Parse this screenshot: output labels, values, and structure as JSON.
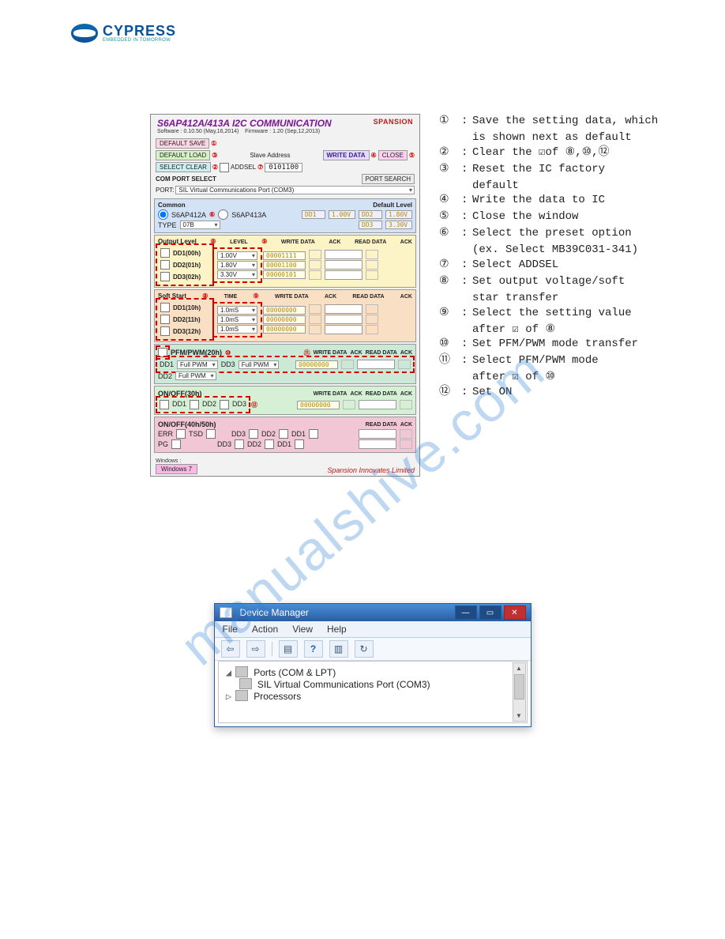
{
  "brand": {
    "name": "CYPRESS",
    "tagline": "EMBEDDED IN TOMORROW"
  },
  "watermark": "manualshive.com",
  "i2cWindow": {
    "title": "S6AP412A/413A I2C COMMUNICATION",
    "software": "Software : 0.10.50 (May,16,2014)",
    "firmware": "Firmware : 1.20 (Sep,12,2013)",
    "vendor": "SPANSION",
    "buttons": {
      "defaultSave": "DEFAULT SAVE",
      "defaultLoad": "DEFAULT LOAD",
      "selectClear": "SELECT CLEAR",
      "writeData": "WRITE DATA",
      "close": "CLOSE",
      "portSearch": "PORT SEARCH"
    },
    "addsel": {
      "label": "ADDSEL",
      "value": "0101100"
    },
    "slaveAddressLabel": "Slave Address",
    "comPortSelectLabel": "COM PORT SELECT",
    "portLabel": "PORT:",
    "portValue": "SIL Virtual Communications Port (COM3)",
    "common": {
      "header": "Common",
      "chipA": "S6AP412A",
      "chipB": "S6AP413A",
      "typeLabel": "TYPE",
      "typeValue": "07B",
      "defaultLevelLabel": "Default Level",
      "dd1": "DD1",
      "dd1v": "1.00V",
      "dd2": "DD2",
      "dd2v": "1.80V",
      "dd3": "DD3",
      "dd3v": "3.30V"
    },
    "colHeaders": {
      "level": "LEVEL",
      "time": "TIME",
      "writeData": "WRITE DATA",
      "ack": "ACK",
      "readData": "READ DATA"
    },
    "outputLevel": {
      "header": "Output Level",
      "rows": [
        {
          "cb": "DD1(00h)",
          "sel": "1.00V",
          "wd": "00001111"
        },
        {
          "cb": "DD2(01h)",
          "sel": "1.80V",
          "wd": "00001100"
        },
        {
          "cb": "DD3(02h)",
          "sel": "3.30V",
          "wd": "00000101"
        }
      ]
    },
    "softStart": {
      "header": "Soft Start",
      "rows": [
        {
          "cb": "DD1(10h)",
          "sel": "1.0mS",
          "wd": "00000000"
        },
        {
          "cb": "DD2(11h)",
          "sel": "1.0mS",
          "wd": "00000000"
        },
        {
          "cb": "DD3(12h)",
          "sel": "1.0mS",
          "wd": "00000000"
        }
      ]
    },
    "pfmPwm": {
      "header": "PFM/PWM(20h)",
      "wd": "00000000",
      "dd1Label": "DD1",
      "dd1Val": "Full PWM",
      "dd2Label": "DD2",
      "dd2Val": "Full PWM",
      "dd3Label": "DD3",
      "dd3Val": "Full PWM"
    },
    "onOff": {
      "header": "ON/OFF(30h)",
      "wd": "00000000",
      "dd1": "DD1",
      "dd2": "DD2",
      "dd3": "DD3"
    },
    "ro": {
      "header": "ON/OFF(40h/50h)",
      "err": "ERR",
      "tsd": "TSD",
      "pg": "PG",
      "dd1": "DD1",
      "dd2": "DD2",
      "dd3": "DD3"
    },
    "footer": {
      "osLabel": "Windows :",
      "osValue": "Windows 7",
      "tagline": "Spansion Innovates Limited"
    },
    "callouts": {
      "c1": "①",
      "c2": "②",
      "c3": "③",
      "c4": "④",
      "c5": "⑤",
      "c6": "⑥",
      "c7": "⑦",
      "c8": "⑧",
      "c9": "⑨",
      "c10": "⑩",
      "c11": "⑪",
      "c12": "⑫"
    }
  },
  "legend": {
    "items": [
      {
        "n": "①",
        "t": "Save the setting data, which",
        "cont": "is shown next as default"
      },
      {
        "n": "②",
        "t": "Clear the ☑of ⑧,⑩,⑫"
      },
      {
        "n": "③",
        "t": "Reset the IC factory",
        "cont": "default"
      },
      {
        "n": "④",
        "t": "Write the data to IC"
      },
      {
        "n": "⑤",
        "t": "Close the window"
      },
      {
        "n": "⑥",
        "t": "Select the preset option",
        "cont": "(ex. Select MB39C031-341)"
      },
      {
        "n": "⑦",
        "t": "Select ADDSEL"
      },
      {
        "n": "⑧",
        "t": "Set output voltage/soft",
        "cont": "star transfer"
      },
      {
        "n": "⑨",
        "t": "Select the setting value",
        "cont": "after ☑ of ⑧"
      },
      {
        "n": "⑩",
        "t": "Set PFM/PWM mode transfer"
      },
      {
        "n": "⑪",
        "t": "Select PFM/PWM mode",
        "cont": "after ☑ of ⑩"
      },
      {
        "n": "⑫",
        "t": "Set ON"
      }
    ]
  },
  "deviceManager": {
    "title": "Device Manager",
    "menu": [
      "File",
      "Action",
      "View",
      "Help"
    ],
    "tree": {
      "ports": "Ports (COM & LPT)",
      "portChild": "SIL Virtual Communications Port (COM3)",
      "processors": "Processors"
    }
  }
}
